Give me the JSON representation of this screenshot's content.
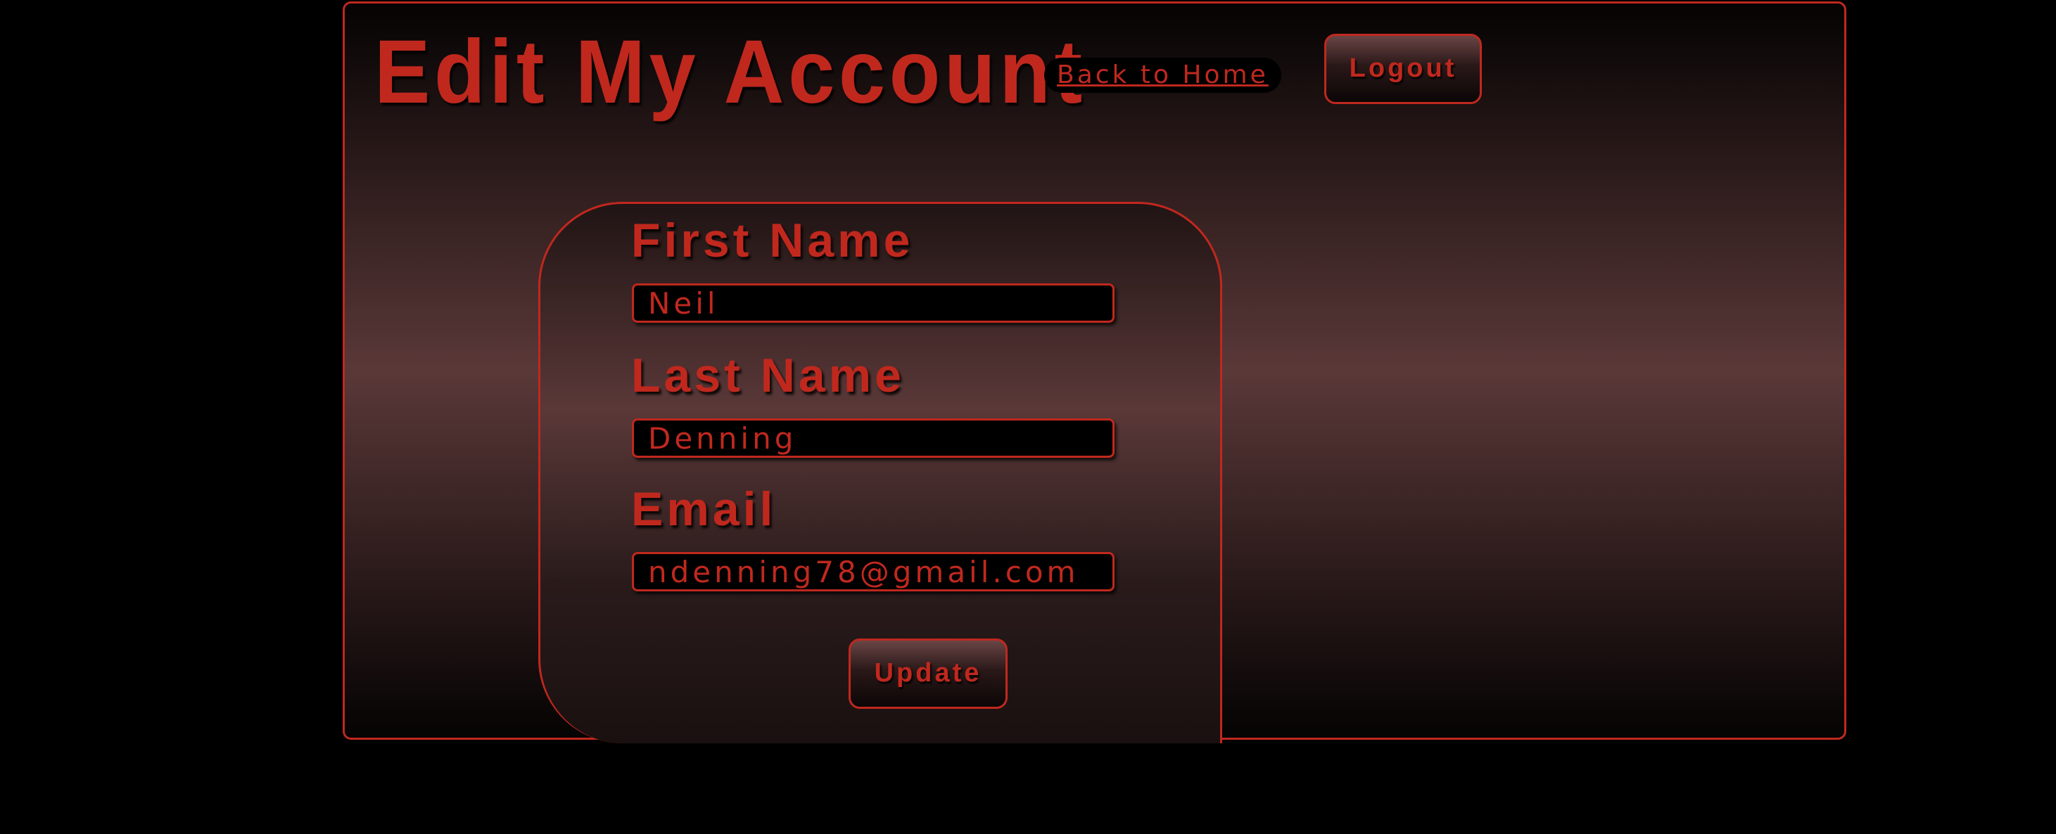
{
  "header": {
    "title": "Edit My Account",
    "home_link": "Back to Home",
    "logout_label": "Logout"
  },
  "form": {
    "first_name": {
      "label": "First Name",
      "value": "Neil"
    },
    "last_name": {
      "label": "Last Name",
      "value": "Denning"
    },
    "email": {
      "label": "Email",
      "value": "ndenning78@gmail.com"
    },
    "submit_label": "Update"
  },
  "colors": {
    "accent": "#c0281e",
    "background": "#000000",
    "panel_mid": "#5a3838"
  }
}
